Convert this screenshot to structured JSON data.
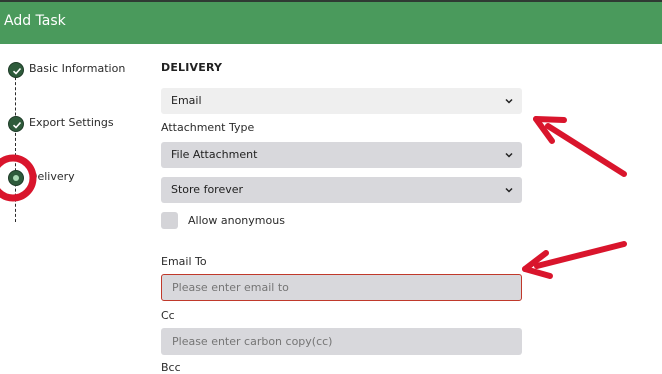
{
  "header": {
    "title": "Add Task"
  },
  "steps": [
    {
      "label": "Basic Information"
    },
    {
      "label": "Export Settings"
    },
    {
      "label": "Delivery"
    }
  ],
  "form": {
    "section_title": "DELIVERY",
    "delivery_method": {
      "value": "Email"
    },
    "attachment_type_label": "Attachment Type",
    "attachment_type": {
      "value": "File Attachment"
    },
    "retention": {
      "value": "Store forever"
    },
    "allow_anonymous_label": "Allow anonymous",
    "email_to_label": "Email To",
    "email_to": {
      "placeholder": "Please enter email to"
    },
    "cc_label": "Cc",
    "cc": {
      "placeholder": "Please enter carbon copy(cc)"
    },
    "bcc_label": "Bcc"
  },
  "colors": {
    "header": "#4a9a5c",
    "annotation": "#d9152c",
    "step_dot": "#2e5b3b"
  },
  "icons": {
    "step_done": "check-icon",
    "select": "chevron-down-icon"
  }
}
